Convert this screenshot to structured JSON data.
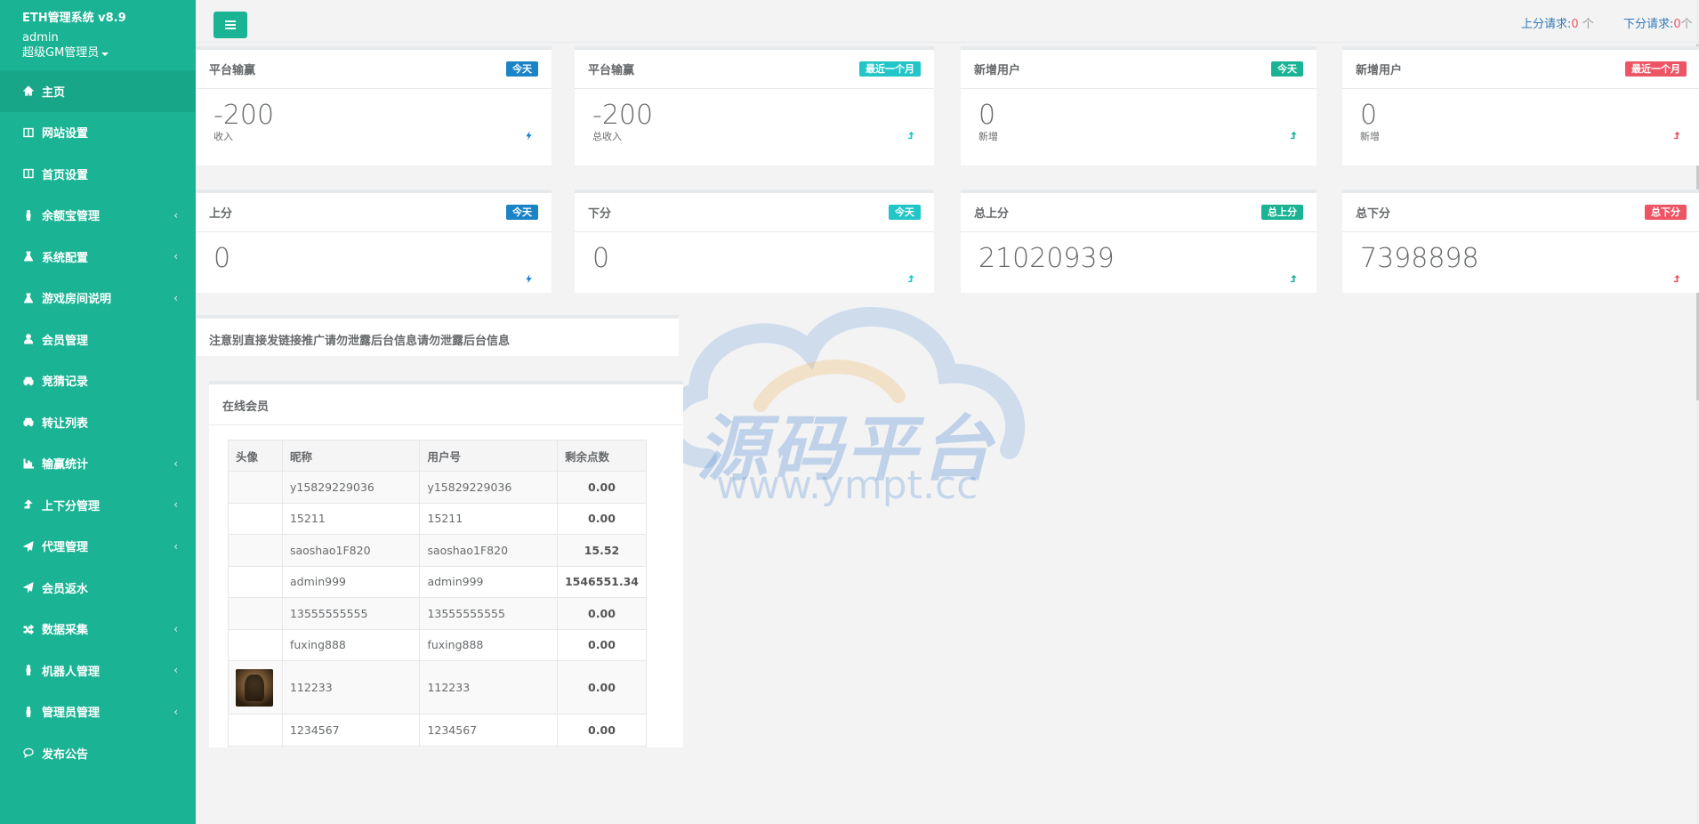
{
  "sidebar": {
    "app_title": "ETH管理系统 v8.9",
    "user_name": "admin",
    "user_role": "超级GM管理员",
    "items": [
      {
        "label": "主页",
        "icon": "home-icon",
        "active": true,
        "has_sub": false
      },
      {
        "label": "网站设置",
        "icon": "columns-icon",
        "has_sub": false
      },
      {
        "label": "首页设置",
        "icon": "columns-icon",
        "has_sub": false
      },
      {
        "label": "余额宝管理",
        "icon": "male-icon",
        "has_sub": true
      },
      {
        "label": "系统配置",
        "icon": "flask-icon",
        "has_sub": true
      },
      {
        "label": "游戏房间说明",
        "icon": "flask-icon",
        "has_sub": true
      },
      {
        "label": "会员管理",
        "icon": "user-icon",
        "has_sub": false
      },
      {
        "label": "竞猜记录",
        "icon": "car-icon",
        "has_sub": false
      },
      {
        "label": "转让列表",
        "icon": "car-icon",
        "has_sub": false
      },
      {
        "label": "输赢统计",
        "icon": "bar-chart-icon",
        "has_sub": true
      },
      {
        "label": "上下分管理",
        "icon": "level-up-icon",
        "has_sub": true
      },
      {
        "label": "代理管理",
        "icon": "paper-plane-icon",
        "has_sub": true
      },
      {
        "label": "会员返水",
        "icon": "paper-plane-icon",
        "has_sub": false
      },
      {
        "label": "数据采集",
        "icon": "random-icon",
        "has_sub": true
      },
      {
        "label": "机器人管理",
        "icon": "male-icon",
        "has_sub": true
      },
      {
        "label": "管理员管理",
        "icon": "male-icon",
        "has_sub": true
      },
      {
        "label": "发布公告",
        "icon": "comment-icon",
        "has_sub": false
      }
    ],
    "chevron": "‹"
  },
  "topbar": {
    "up_request_label": "上分请求:",
    "up_request_count": "0",
    "up_request_unit": "个",
    "down_request_label": "下分请求:",
    "down_request_count": "0",
    "down_request_unit": "个"
  },
  "cards_row1": [
    {
      "title": "平台输赢",
      "badge": "今天",
      "badge_color": "#1c84c6",
      "value": "-200",
      "sub": "收入",
      "trend": "bolt-icon",
      "trend_color": "#1c84c6"
    },
    {
      "title": "平台输赢",
      "badge": "最近一个月",
      "badge_color": "#23c6c8",
      "value": "-200",
      "sub": "总收入",
      "trend": "level-up-icon",
      "trend_color": "#23c6c8"
    },
    {
      "title": "新增用户",
      "badge": "今天",
      "badge_color": "#1ab394",
      "value": "0",
      "sub": "新增",
      "trend": "level-up-icon",
      "trend_color": "#1ab394"
    },
    {
      "title": "新增用户",
      "badge": "最近一个月",
      "badge_color": "#ed5565",
      "value": "0",
      "sub": "新增",
      "trend": "level-up-icon",
      "trend_color": "#ed5565"
    }
  ],
  "cards_row2": [
    {
      "title": "上分",
      "badge": "今天",
      "badge_color": "#1c84c6",
      "value": "0",
      "trend": "bolt-icon",
      "trend_color": "#1c84c6"
    },
    {
      "title": "下分",
      "badge": "今天",
      "badge_color": "#23c6c8",
      "value": "0",
      "trend": "level-up-icon",
      "trend_color": "#23c6c8"
    },
    {
      "title": "总上分",
      "badge": "总上分",
      "badge_color": "#1ab394",
      "value": "21020939",
      "trend": "level-up-icon",
      "trend_color": "#1ab394"
    },
    {
      "title": "总下分",
      "badge": "总下分",
      "badge_color": "#ed5565",
      "value": "7398898",
      "trend": "level-up-icon",
      "trend_color": "#ed5565"
    }
  ],
  "notice": "注意别直接发链接推广请勿泄露后台信息请勿泄露后台信息",
  "online": {
    "title": "在线会员",
    "columns": [
      "头像",
      "昵称",
      "用户号",
      "剩余点数"
    ],
    "rows": [
      {
        "avatar": false,
        "nick": "y15829229036",
        "uid": "y15829229036",
        "points": "0.00"
      },
      {
        "avatar": false,
        "nick": "15211",
        "uid": "15211",
        "points": "0.00"
      },
      {
        "avatar": false,
        "nick": "saoshao1F820",
        "uid": "saoshao1F820",
        "points": "15.52"
      },
      {
        "avatar": false,
        "nick": "admin999",
        "uid": "admin999",
        "points": "1546551.34"
      },
      {
        "avatar": false,
        "nick": "13555555555",
        "uid": "13555555555",
        "points": "0.00"
      },
      {
        "avatar": false,
        "nick": "fuxing888",
        "uid": "fuxing888",
        "points": "0.00"
      },
      {
        "avatar": true,
        "nick": "112233",
        "uid": "112233",
        "points": "0.00"
      },
      {
        "avatar": false,
        "nick": "1234567",
        "uid": "1234567",
        "points": "0.00"
      }
    ]
  },
  "watermark": {
    "text": "源码平台",
    "url": "www.ympt.cc"
  }
}
